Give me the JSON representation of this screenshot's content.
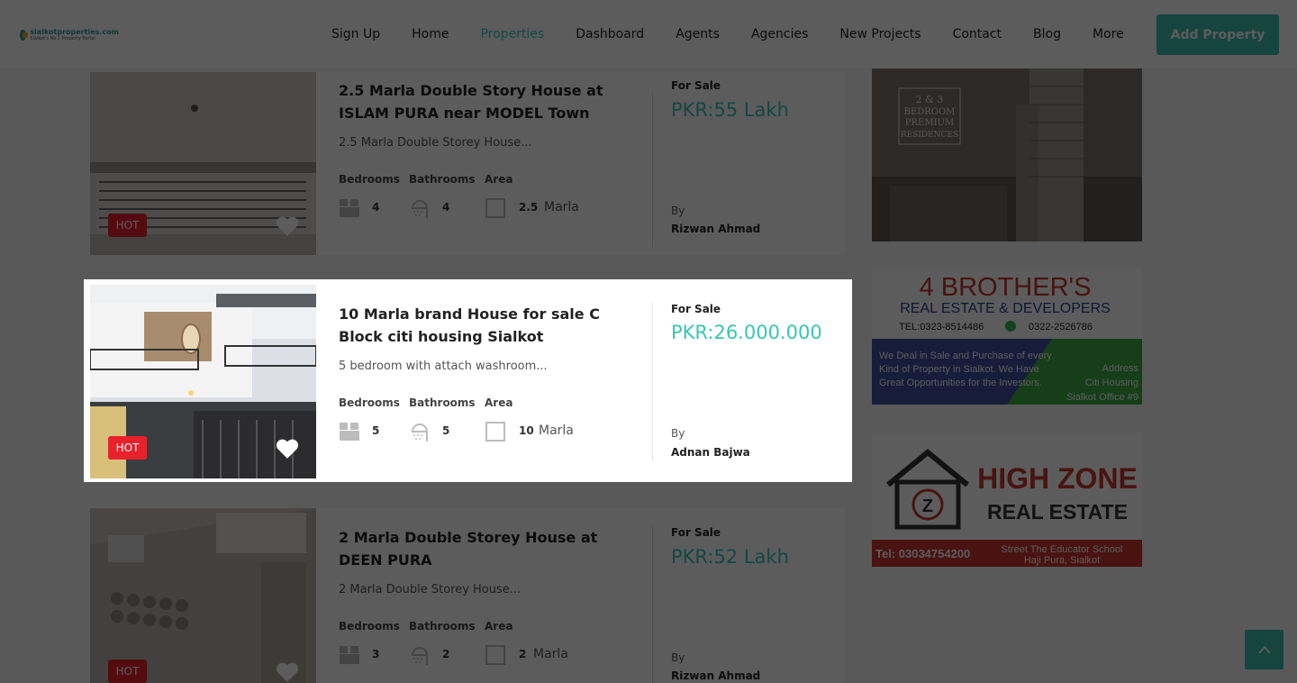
{
  "nav": {
    "logo_line1": "sialkotproperties.com",
    "logo_line2": "Sialkot's No.1 Property Portal",
    "items": [
      {
        "label": "Sign Up",
        "active": false
      },
      {
        "label": "Home",
        "active": false
      },
      {
        "label": "Properties",
        "active": true
      },
      {
        "label": "Dashboard",
        "active": false
      },
      {
        "label": "Agents",
        "active": false
      },
      {
        "label": "Agencies",
        "active": false
      },
      {
        "label": "New Projects",
        "active": false
      },
      {
        "label": "Contact",
        "active": false
      },
      {
        "label": "Blog",
        "active": false
      },
      {
        "label": "More",
        "active": false
      }
    ],
    "add_property": "Add Property"
  },
  "labels": {
    "bedrooms": "Bedrooms",
    "bathrooms": "Bathrooms",
    "area": "Area",
    "by": "By",
    "hot": "HOT"
  },
  "listings": [
    {
      "title": "2.5 Marla Double Story House at ISLAM PURA near MODEL Town",
      "desc": "2.5 Marla Double Storey House...",
      "bedrooms": "4",
      "bathrooms": "4",
      "area_value": "2.5",
      "area_unit": "Marla",
      "status": "For Sale",
      "price": "PKR:55 Lakh",
      "agent": "Rizwan Ahmad"
    },
    {
      "title": "10 Marla brand House for sale C Block citi housing Sialkot",
      "desc": "5 bedroom with attach washroom...",
      "bedrooms": "5",
      "bathrooms": "5",
      "area_value": "10",
      "area_unit": "Marla",
      "status": "For Sale",
      "price": "PKR:26.000.000",
      "agent": "Adnan Bajwa"
    },
    {
      "title": "2 Marla Double Storey House at DEEN PURA",
      "desc": "2 Marla Double Storey House...",
      "bedrooms": "3",
      "bathrooms": "2",
      "area_value": "2",
      "area_unit": "Marla",
      "status": "For Sale",
      "price": "PKR:52 Lakh",
      "agent": "Rizwan Ahmad"
    }
  ],
  "ads": {
    "ad1_line1": "2 & 3",
    "ad1_line2": "BEDROOM",
    "ad1_line3": "PREMIUM",
    "ad1_line4": "RESIDENCES",
    "ad2_title": "4 BROTHER'S",
    "ad2_subtitle": "REAL ESTATE & DEVELOPERS",
    "ad2_tel": "TEL:0323-8514486",
    "ad2_tel2": "0322-2526786",
    "ad2_text1": "We Deal in Sale and Purchase of every",
    "ad2_text2": "Kind of Property in Sialkot. We Have",
    "ad2_text3": "Great Opportunities for the Investors.",
    "ad2_addr1": "Address",
    "ad2_addr2": "Citi Housing",
    "ad2_addr3": "Sialkot Office #9",
    "ad3_line1": "HIGH ZONE",
    "ad3_line2": "REAL ESTATE",
    "ad3_tel": "Tel: 03034754200",
    "ad3_addr1": "Street The Educator School",
    "ad3_addr2": "Haji Pura, Sialkot"
  },
  "colors": {
    "accent": "#3dbcb0",
    "price": "#39c6b3",
    "hot": "#e8212b"
  }
}
